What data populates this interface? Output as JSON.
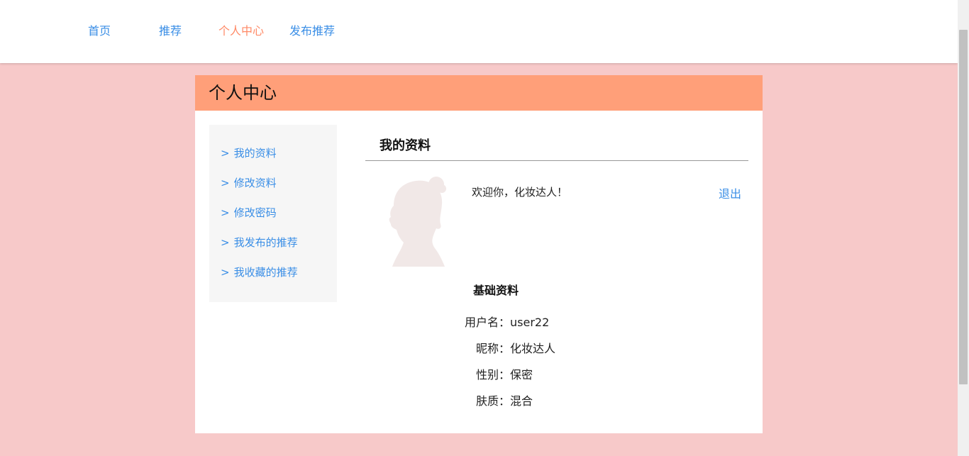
{
  "nav": {
    "items": [
      {
        "label": "首页"
      },
      {
        "label": "推荐"
      },
      {
        "label": "个人中心"
      },
      {
        "label": "发布推荐"
      }
    ],
    "active_index": 2
  },
  "page": {
    "header": "个人中心"
  },
  "sidebar": {
    "caret": ">",
    "items": [
      {
        "label": "我的资料"
      },
      {
        "label": "修改资料"
      },
      {
        "label": "修改密码"
      },
      {
        "label": "我发布的推荐"
      },
      {
        "label": "我收藏的推荐"
      }
    ]
  },
  "profile": {
    "section_title": "我的资料",
    "welcome": "欢迎你，化妆达人！",
    "logout_label": "退出",
    "basic_title": "基础资料",
    "fields": [
      {
        "key": "用户名：",
        "value": "user22"
      },
      {
        "key": "昵称：",
        "value": "化妆达人"
      },
      {
        "key": "性别：",
        "value": "保密"
      },
      {
        "key": "肤质：",
        "value": "混合"
      }
    ]
  },
  "colors": {
    "background": "#f7c9c9",
    "header": "#ff9f79",
    "link": "#3a8ee6",
    "active": "#ff8a67"
  }
}
